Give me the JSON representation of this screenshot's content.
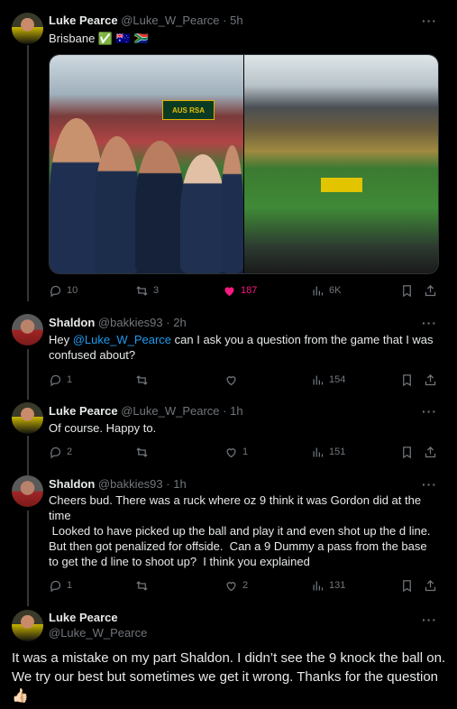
{
  "tweets": [
    {
      "name": "Luke Pearce",
      "handle": "@Luke_W_Pearce",
      "time": "· 5h",
      "text": "Brisbane ✅ 🇦🇺 🇿🇦",
      "media_sign": "AUS RSA",
      "replies": "10",
      "retweets": "3",
      "likes": "187",
      "views": "6K"
    },
    {
      "name": "Shaldon",
      "handle": "@bakkies93",
      "time": "· 2h",
      "text_prefix": "Hey ",
      "mention": "@Luke_W_Pearce",
      "text_suffix": " can I ask you a question from the game that I was confused about?",
      "replies": "1",
      "retweets": "",
      "likes": "",
      "views": "154"
    },
    {
      "name": "Luke Pearce",
      "handle": "@Luke_W_Pearce",
      "time": "· 1h",
      "text": "Of course. Happy to.",
      "replies": "2",
      "retweets": "",
      "likes": "1",
      "views": "151"
    },
    {
      "name": "Shaldon",
      "handle": "@bakkies93",
      "time": "· 1h",
      "text_lines": [
        "Cheers bud.  There was a ruck where oz 9 think it was Gordon did at the time",
        " Looked to have picked up the ball and play it and even shot up the d line. But then got penalized for offside.  Can a 9 Dummy a pass from the base to get the d line to shoot up?  I think you explained"
      ],
      "replies": "1",
      "retweets": "",
      "likes": "2",
      "views": "131"
    }
  ],
  "focused": {
    "name": "Luke Pearce",
    "handle": "@Luke_W_Pearce",
    "text": "It was a mistake on my part Shaldon. I didn’t see the 9 knock the ball on. We try our best but sometimes we get it wrong. Thanks for the question 👍🏻"
  },
  "more_glyph": "···",
  "colors": {
    "background": "#000000",
    "text": "#e7e9ea",
    "muted": "#71767b",
    "link": "#1d9bf0",
    "like_active": "#f91880"
  }
}
